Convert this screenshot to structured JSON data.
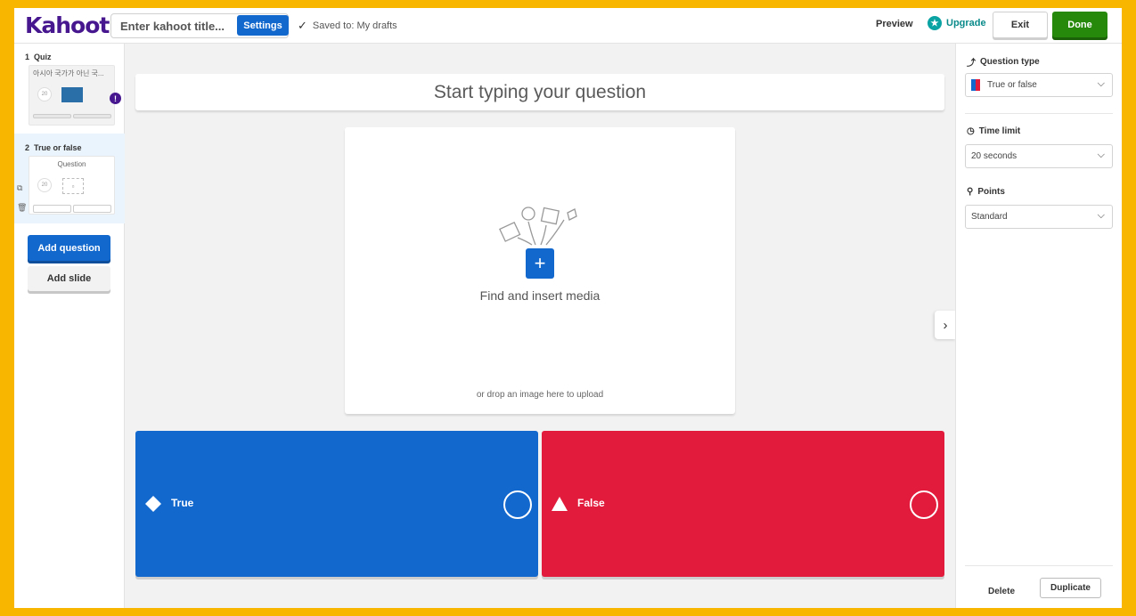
{
  "app": {
    "logo": "Kahoot!"
  },
  "header": {
    "title_placeholder": "Enter kahoot title...",
    "settings_label": "Settings",
    "saved_text": "Saved to: My drafts",
    "preview_label": "Preview",
    "upgrade_label": "Upgrade",
    "exit_label": "Exit",
    "done_label": "Done"
  },
  "sidebar": {
    "slides": [
      {
        "number": "1",
        "type": "Quiz",
        "preview_text": "아시아 국가가 아닌 국...",
        "timer": "20"
      },
      {
        "number": "2",
        "type": "True or false",
        "preview_text": "Question",
        "timer": "20"
      }
    ],
    "add_question_label": "Add question",
    "add_slide_label": "Add slide"
  },
  "editor": {
    "question_placeholder": "Start typing your question",
    "media_label": "Find and insert media",
    "media_drop_text": "or drop an image here to upload",
    "answers": [
      {
        "label": "True",
        "color": "#1368ce",
        "shape": "diamond-icon"
      },
      {
        "label": "False",
        "color": "#e21b3c",
        "shape": "triangle-icon"
      }
    ]
  },
  "right_panel": {
    "question_type_label": "Question type",
    "question_type_value": "True or false",
    "time_limit_label": "Time limit",
    "time_limit_value": "20 seconds",
    "points_label": "Points",
    "points_value": "Standard",
    "delete_label": "Delete",
    "duplicate_label": "Duplicate"
  },
  "colors": {
    "frame": "#f8b600",
    "primary": "#1368ce",
    "brand": "#46178f",
    "done": "#26890c",
    "false": "#e21b3c"
  }
}
